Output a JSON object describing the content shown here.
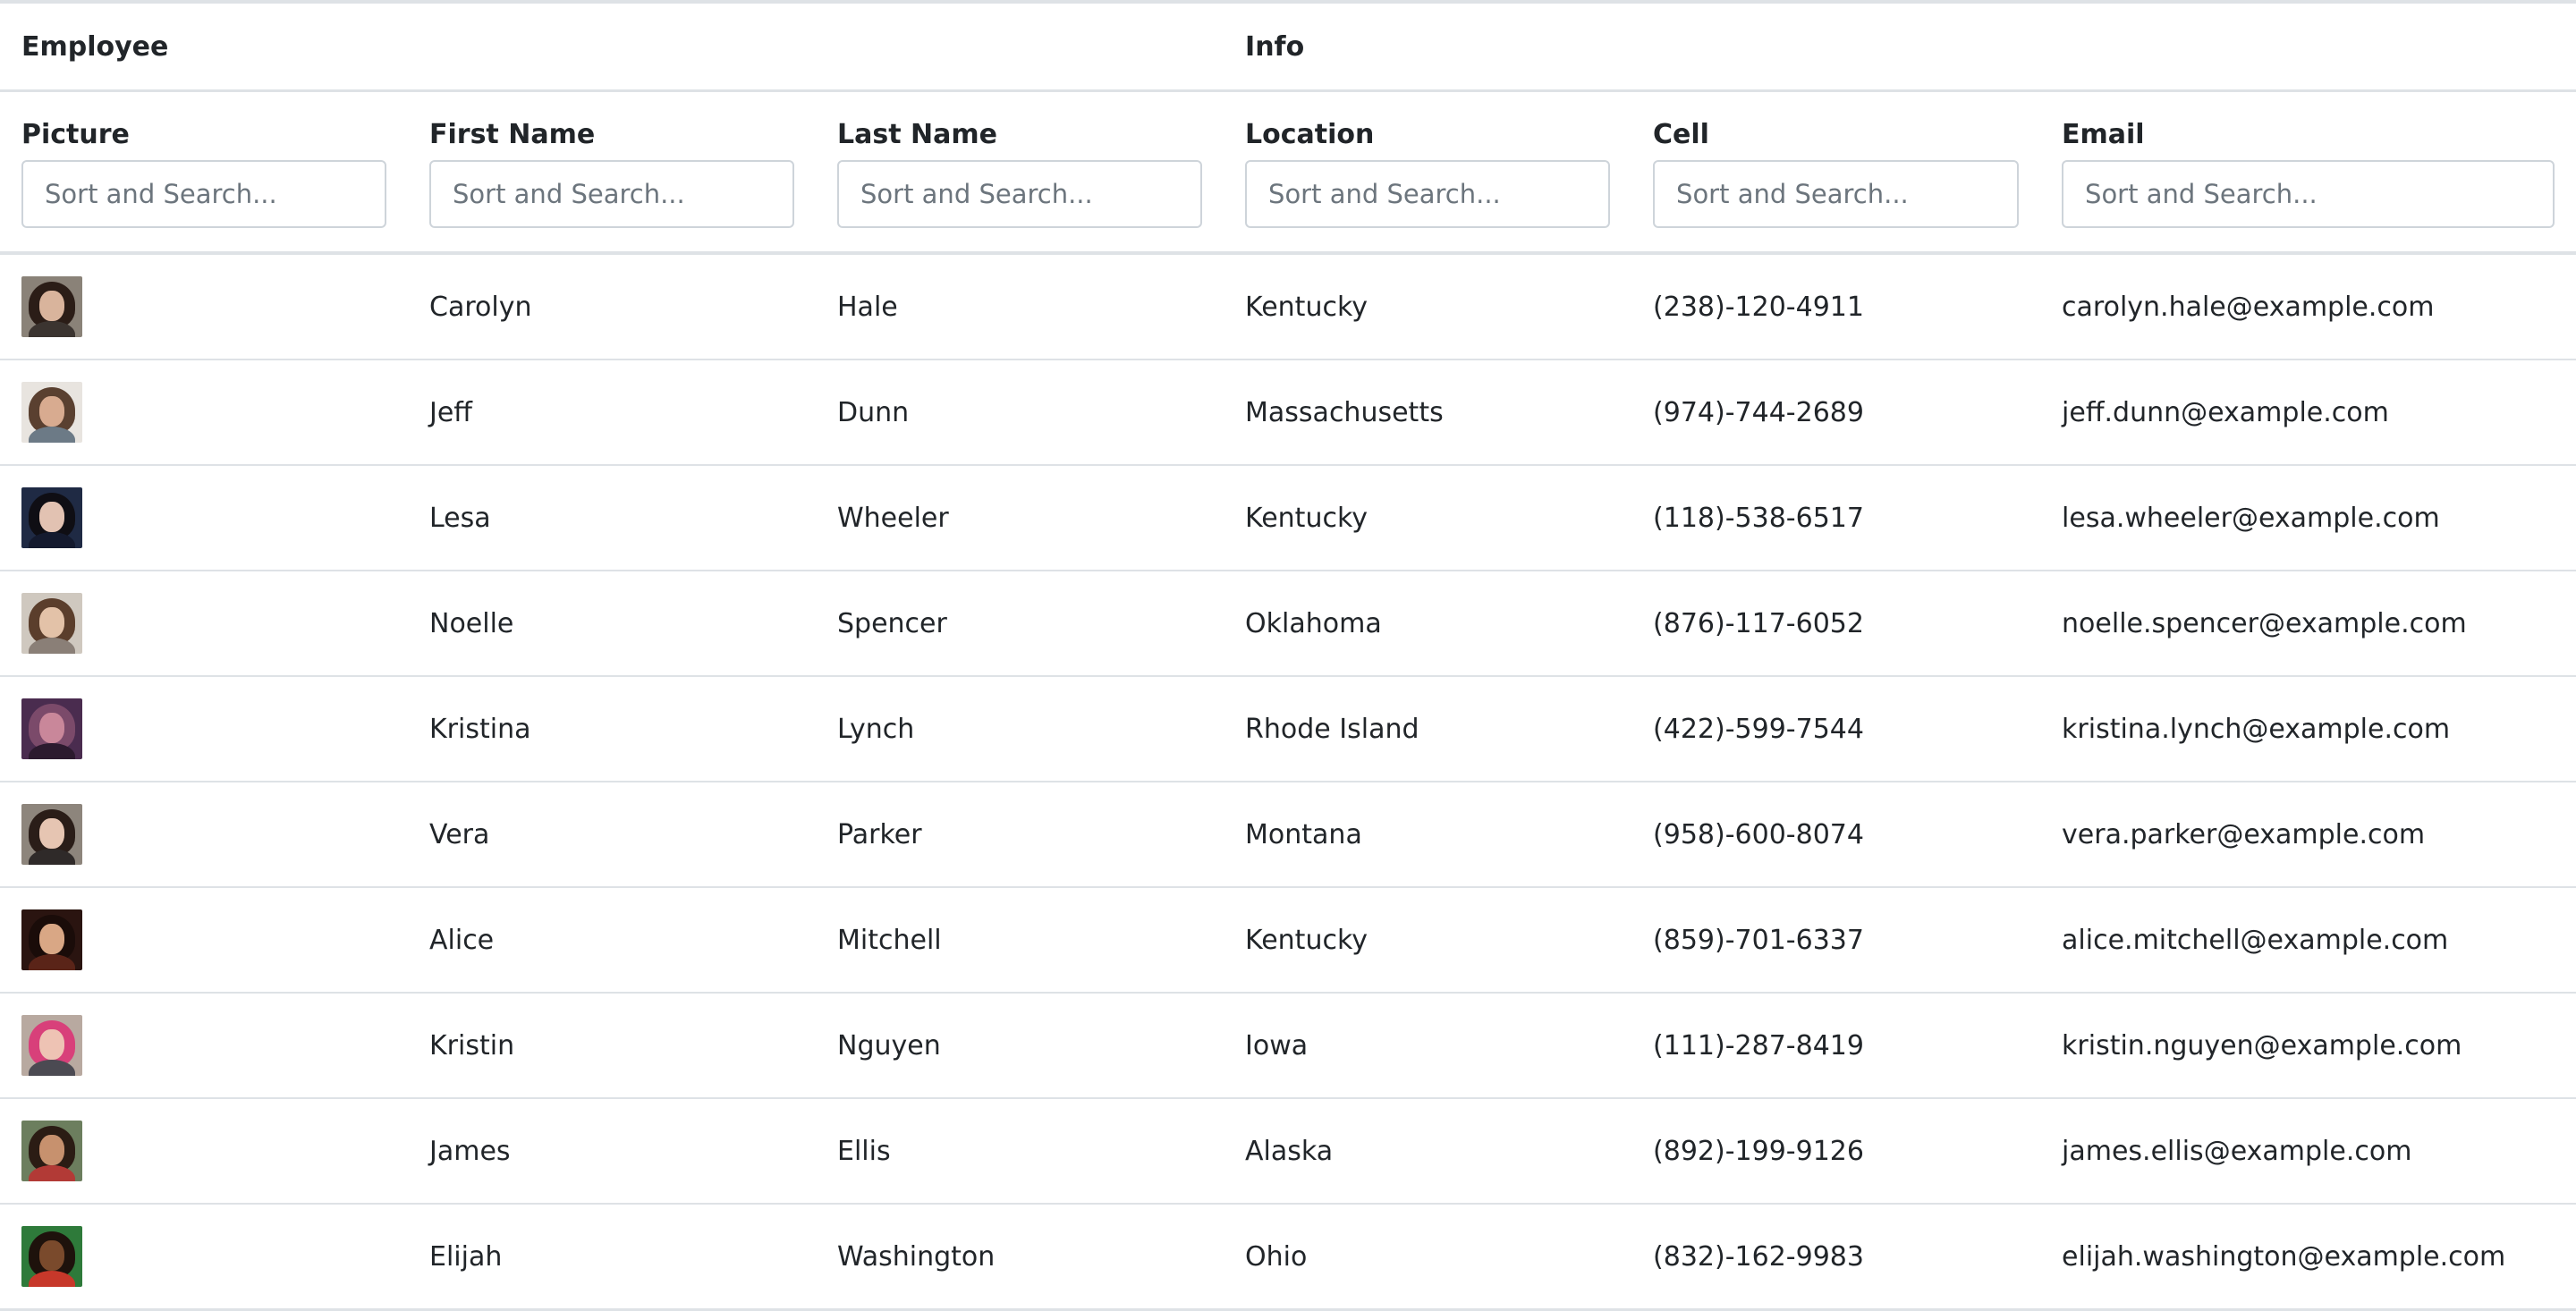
{
  "header": {
    "group_employee": "Employee",
    "group_info": "Info"
  },
  "columns": {
    "picture": "Picture",
    "first_name": "First Name",
    "last_name": "Last Name",
    "location": "Location",
    "cell": "Cell",
    "email": "Email"
  },
  "filter": {
    "placeholder": "Sort and Search..."
  },
  "rows": [
    {
      "first": "Carolyn",
      "last": "Hale",
      "location": "Kentucky",
      "cell": "(238)-120-4911",
      "email": "carolyn.hale@example.com",
      "avatar": {
        "bg": "#8a8278",
        "hair": "#2b1d17",
        "skin": "#d9b49c",
        "shirt": "#3b3430"
      }
    },
    {
      "first": "Jeff",
      "last": "Dunn",
      "location": "Massachusetts",
      "cell": "(974)-744-2689",
      "email": "jeff.dunn@example.com",
      "avatar": {
        "bg": "#e8e4df",
        "hair": "#5a4030",
        "skin": "#d8ab90",
        "shirt": "#6c7a86"
      }
    },
    {
      "first": "Lesa",
      "last": "Wheeler",
      "location": "Kentucky",
      "cell": "(118)-538-6517",
      "email": "lesa.wheeler@example.com",
      "avatar": {
        "bg": "#1f2a44",
        "hair": "#0f0e14",
        "skin": "#e2c2b2",
        "shirt": "#141a2e"
      }
    },
    {
      "first": "Noelle",
      "last": "Spencer",
      "location": "Oklahoma",
      "cell": "(876)-117-6052",
      "email": "noelle.spencer@example.com",
      "avatar": {
        "bg": "#cfc8bf",
        "hair": "#5b3e2c",
        "skin": "#e3c2a8",
        "shirt": "#8a7f77"
      }
    },
    {
      "first": "Kristina",
      "last": "Lynch",
      "location": "Rhode Island",
      "cell": "(422)-599-7544",
      "email": "kristina.lynch@example.com",
      "avatar": {
        "bg": "#4a2c4f",
        "hair": "#7b4a6a",
        "skin": "#c9879a",
        "shirt": "#2c1a2e"
      }
    },
    {
      "first": "Vera",
      "last": "Parker",
      "location": "Montana",
      "cell": "(958)-600-8074",
      "email": "vera.parker@example.com",
      "avatar": {
        "bg": "#8d857c",
        "hair": "#2a1d18",
        "skin": "#e6c5b2",
        "shirt": "#2f2a29"
      }
    },
    {
      "first": "Alice",
      "last": "Mitchell",
      "location": "Kentucky",
      "cell": "(859)-701-6337",
      "email": "alice.mitchell@example.com",
      "avatar": {
        "bg": "#2a1410",
        "hair": "#1a0c09",
        "skin": "#d9a785",
        "shirt": "#5a2418"
      }
    },
    {
      "first": "Kristin",
      "last": "Nguyen",
      "location": "Iowa",
      "cell": "(111)-287-8419",
      "email": "kristin.nguyen@example.com",
      "avatar": {
        "bg": "#b8a9a0",
        "hair": "#d8407a",
        "skin": "#eec3b4",
        "shirt": "#4b4a52"
      }
    },
    {
      "first": "James",
      "last": "Ellis",
      "location": "Alaska",
      "cell": "(892)-199-9126",
      "email": "james.ellis@example.com",
      "avatar": {
        "bg": "#6c7e5e",
        "hair": "#2b1c14",
        "skin": "#c7916e",
        "shirt": "#b23a36"
      }
    },
    {
      "first": "Elijah",
      "last": "Washington",
      "location": "Ohio",
      "cell": "(832)-162-9983",
      "email": "elijah.washington@example.com",
      "avatar": {
        "bg": "#2e7a3a",
        "hair": "#1e120c",
        "skin": "#7a4a2c",
        "shirt": "#c7382a"
      }
    }
  ]
}
